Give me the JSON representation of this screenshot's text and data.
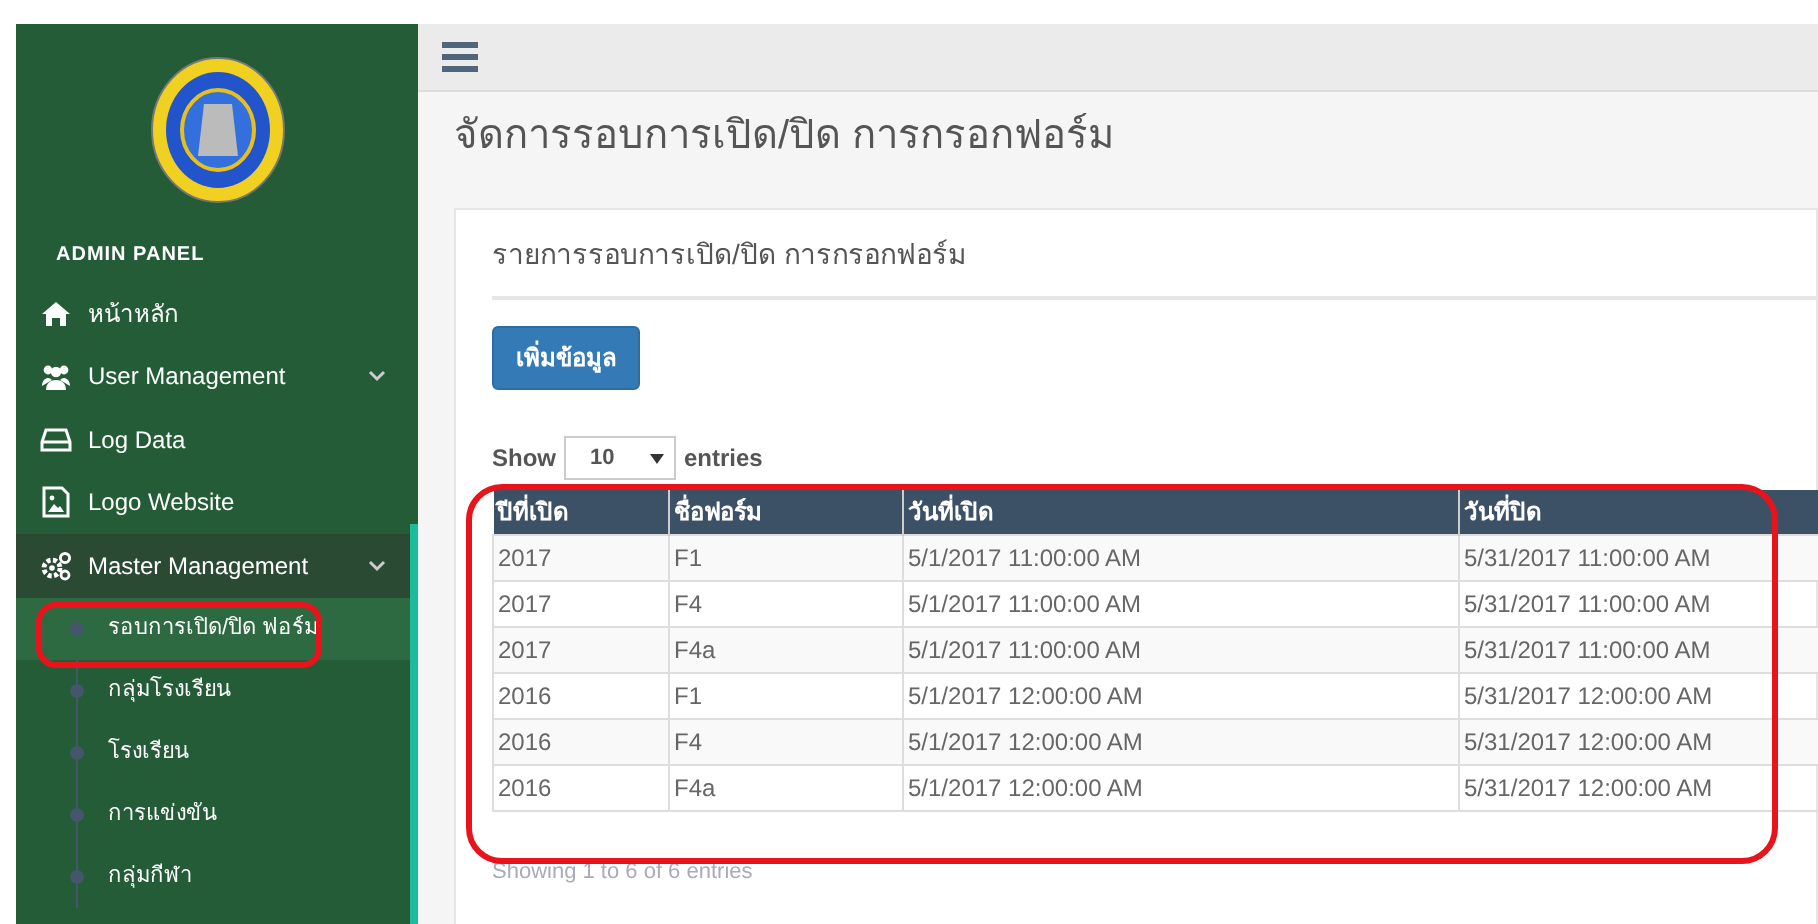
{
  "sidebar": {
    "title": "ADMIN PANEL",
    "items": [
      {
        "label": "หน้าหลัก"
      },
      {
        "label": "User Management",
        "expanded": false
      },
      {
        "label": "Log Data"
      },
      {
        "label": "Logo Website"
      },
      {
        "label": "Master Management",
        "expanded": true,
        "children": [
          {
            "label": "รอบการเปิด/ปิด ฟอร์ม",
            "selected": true,
            "highlighted": true
          },
          {
            "label": "กลุ่มโรงเรียน",
            "selected": false,
            "highlighted": false
          },
          {
            "label": "โรงเรียน",
            "selected": false,
            "highlighted": false
          },
          {
            "label": "การแข่งขัน",
            "selected": false,
            "highlighted": false
          },
          {
            "label": "กลุ่มกีฬา",
            "selected": false,
            "highlighted": false
          }
        ]
      }
    ]
  },
  "page_title": "จัดการรอบการเปิด/ปิด การกรอกฟอร์ม",
  "card": {
    "title": "รายการรอบการเปิด/ปิด การกรอกฟอร์ม",
    "add_button": "เพิ่มข้อมูล",
    "length": {
      "before": "Show",
      "value": "10",
      "after": "entries"
    },
    "table": {
      "highlighted": true,
      "columns": [
        "ปีที่เปิด",
        "ชื่อฟอร์ม",
        "วันที่เปิด",
        "วันที่ปิด"
      ],
      "rows": [
        [
          "2017",
          "F1",
          "5/1/2017 11:00:00 AM",
          "5/31/2017 11:00:00 AM"
        ],
        [
          "2017",
          "F4",
          "5/1/2017 11:00:00 AM",
          "5/31/2017 11:00:00 AM"
        ],
        [
          "2017",
          "F4a",
          "5/1/2017 11:00:00 AM",
          "5/31/2017 11:00:00 AM"
        ],
        [
          "2016",
          "F1",
          "5/1/2017 12:00:00 AM",
          "5/31/2017 12:00:00 AM"
        ],
        [
          "2016",
          "F4",
          "5/1/2017 12:00:00 AM",
          "5/31/2017 12:00:00 AM"
        ],
        [
          "2016",
          "F4a",
          "5/1/2017 12:00:00 AM",
          "5/31/2017 12:00:00 AM"
        ]
      ]
    },
    "info": "Showing 1 to 6 of 6 entries"
  }
}
